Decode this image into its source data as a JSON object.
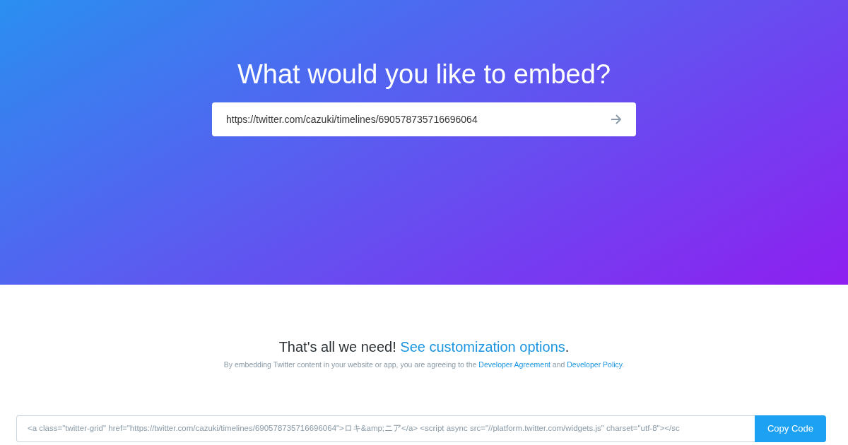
{
  "hero": {
    "title": "What would you like to embed?",
    "url_field": {
      "value": "https://twitter.com/cazuki/timelines/690578735716696064"
    }
  },
  "result": {
    "headline": [
      {
        "kind": "text",
        "text": "That's all we need!"
      },
      {
        "kind": "link",
        "text": "See customization options"
      },
      {
        "kind": "text",
        "text": "."
      }
    ],
    "notice": [
      {
        "kind": "text",
        "text": "By embedding Twitter content in your website or app, you are agreeing to the"
      },
      {
        "kind": "link",
        "text": "Developer Agreement"
      },
      {
        "kind": "text",
        "text": "and"
      },
      {
        "kind": "link",
        "text": "Developer Policy"
      },
      {
        "kind": "text",
        "text": "."
      }
    ],
    "code": "<a class=\"twitter-grid\" href=\"https://twitter.com/cazuki/timelines/690578735716696064\">ロキ&amp;ニア</a> <script async src=\"//platform.twitter.com/widgets.js\" charset=\"utf-8\"></sc",
    "copy_button": "Copy Code"
  }
}
